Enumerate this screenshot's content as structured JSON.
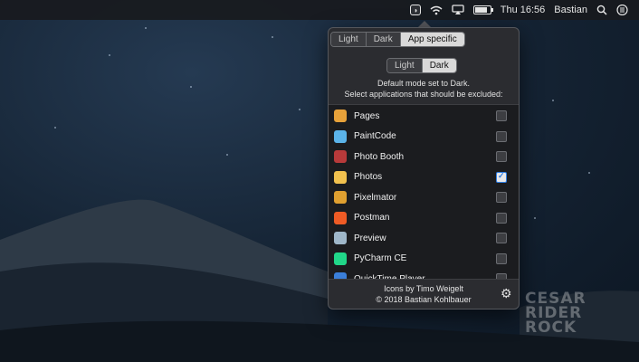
{
  "menubar": {
    "app_icon_glyph": "◑",
    "clock": "Thu 16:56",
    "user": "Bastian",
    "icons": [
      "app-toggle-icon",
      "wifi-icon",
      "airplay-icon",
      "battery-icon",
      "search-icon",
      "list-icon"
    ],
    "battery_level": 0.8
  },
  "popover": {
    "mode_tabs": [
      {
        "label": "Light",
        "selected": false
      },
      {
        "label": "Dark",
        "selected": false
      },
      {
        "label": "App specific",
        "selected": true
      }
    ],
    "default_tabs": [
      {
        "label": "Light",
        "selected": false
      },
      {
        "label": "Dark",
        "selected": true
      }
    ],
    "description_line1": "Default mode set to Dark.",
    "description_line2": "Select applications that should be excluded:",
    "apps": [
      {
        "name": "Pages",
        "icon": "pages-icon",
        "color": "#e8a23a",
        "checked": false
      },
      {
        "name": "PaintCode",
        "icon": "paintcode-icon",
        "color": "#5bb3e8",
        "checked": false
      },
      {
        "name": "Photo Booth",
        "icon": "photo-booth-icon",
        "color": "#b83a3a",
        "checked": false
      },
      {
        "name": "Photos",
        "icon": "photos-icon",
        "color": "#f2c14e",
        "checked": true
      },
      {
        "name": "Pixelmator",
        "icon": "pixelmator-icon",
        "color": "#e0a030",
        "checked": false
      },
      {
        "name": "Postman",
        "icon": "postman-icon",
        "color": "#ef5b25",
        "checked": false
      },
      {
        "name": "Preview",
        "icon": "preview-icon",
        "color": "#9fb7c9",
        "checked": false
      },
      {
        "name": "PyCharm CE",
        "icon": "pycharm-icon",
        "color": "#21d789",
        "checked": false
      },
      {
        "name": "QuickTime Player",
        "icon": "quicktime-icon",
        "color": "#3b7fd9",
        "checked": false
      }
    ],
    "footer_line1": "Icons by Timo Weigelt",
    "footer_line2": "© 2018 Bastian Kohlbauer"
  },
  "watermark": {
    "line1": "CESAR",
    "line2": "RIDER",
    "line3": "ROCK"
  }
}
